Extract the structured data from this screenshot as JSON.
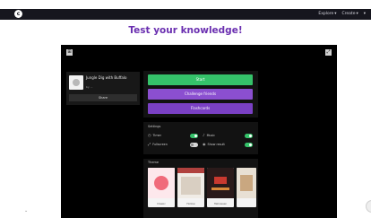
{
  "topbar": {
    "logo_icon": "c",
    "nav": [
      {
        "label": "Explore",
        "icon": "chevron-down-icon"
      },
      {
        "label": "Create",
        "icon": "chevron-down-icon"
      },
      {
        "label": "",
        "icon": "chevron-down-icon"
      }
    ]
  },
  "page": {
    "title": "Test your knowledge!"
  },
  "player": {
    "left_button": "⊞",
    "right_button": "⤢",
    "game": {
      "name": "Jungle Dig with Buffalo",
      "sub": "by ...",
      "share_label": "Share"
    },
    "actions": {
      "primary": "Start",
      "challenge": "Challenge friends",
      "flashcards": "Flashcards"
    },
    "settings": {
      "title": "Settings",
      "items": [
        {
          "label": "Timer",
          "icon": "clock-icon",
          "glyph": "◷",
          "on": true
        },
        {
          "label": "Music",
          "icon": "music-icon",
          "glyph": "♪",
          "on": true
        },
        {
          "label": "Fullscreen",
          "icon": "expand-icon",
          "glyph": "⤢",
          "on": false
        },
        {
          "label": "Show result",
          "icon": "eye-icon",
          "glyph": "◉",
          "on": true
        }
      ]
    },
    "themes": {
      "title": "Theme",
      "items": [
        {
          "label": "Classic",
          "color": "#f06a7a"
        },
        {
          "label": "Hollow",
          "color": "#b0413e"
        },
        {
          "label": "Halloween",
          "color": "#2a1a1a"
        },
        {
          "label": "Other",
          "color": "#e8e0d4"
        }
      ]
    }
  },
  "footer": {
    "scroll_icon": "⌄",
    "side_icon": "›"
  },
  "colors": {
    "title": "#6a2fb0",
    "green": "#35c26a",
    "purple": "#8b4fd0",
    "topbar": "#16161e"
  }
}
